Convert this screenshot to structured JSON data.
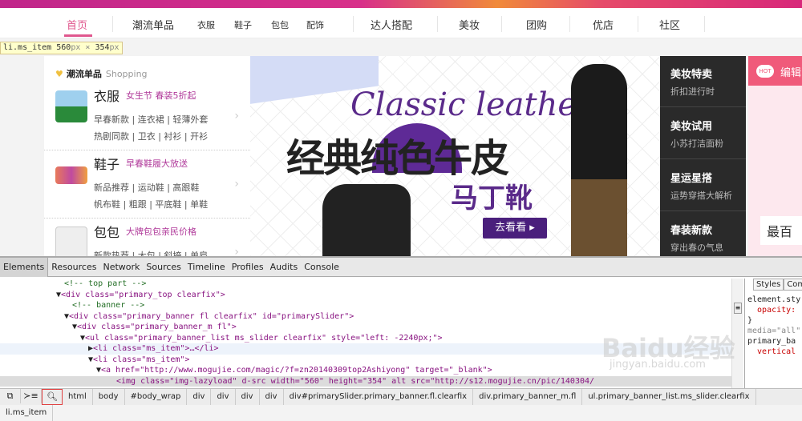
{
  "nav": {
    "items": [
      "首页",
      "潮流单品",
      "衣服",
      "鞋子",
      "包包",
      "配饰",
      "达人搭配",
      "美妆",
      "团购",
      "优店",
      "社区"
    ]
  },
  "tooltip": {
    "selector": "li.ms_item",
    "width": "560",
    "height": "354",
    "unit": "px",
    "times": "×"
  },
  "left_panel": {
    "heading": "潮流单品",
    "heading_en": "Shopping",
    "categories": [
      {
        "title": "衣服",
        "promo": "女生节 春装5折起",
        "row1": "早春新款 | 连衣裙 | 轻薄外套",
        "row2": "热剧同款 | 卫衣 | 衬衫 | 开衫"
      },
      {
        "title": "鞋子",
        "promo": "早春鞋履大放送",
        "row1": "新品推荐 | 运动鞋 | 高跟鞋",
        "row2": "帆布鞋 | 粗跟 | 平底鞋 | 单鞋"
      },
      {
        "title": "包包",
        "promo": "大牌包包亲民价格",
        "row1": "新款热荐 | 大包 | 斜挎 | 单肩"
      }
    ]
  },
  "banner": {
    "script": "Classic leather",
    "headline": "经典纯色牛皮",
    "sub": "马丁靴",
    "button": "去看看 ▸",
    "accent": "#4a1f7c"
  },
  "dark_menu": [
    {
      "title": "美妆特卖",
      "sub": "折扣进行时"
    },
    {
      "title": "美妆试用",
      "sub": "小苏打洁面粉"
    },
    {
      "title": "星运星搭",
      "sub": "运势穿搭大解析"
    },
    {
      "title": "春装新款",
      "sub": "穿出春の气息"
    }
  ],
  "right_card": {
    "badge": "HOT",
    "title": "编辑",
    "box": "最百"
  },
  "devtools": {
    "tabs": [
      "Elements",
      "Resources",
      "Network",
      "Sources",
      "Timeline",
      "Profiles",
      "Audits",
      "Console"
    ],
    "code": [
      "<!-- top part -->",
      "<div class=\"primary_top clearfix\">",
      "<!-- banner -->",
      "<div class=\"primary_banner fl clearfix\" id=\"primarySlider\">",
      "<div class=\"primary_banner_m fl\">",
      "<ul class=\"primary_banner_list ms_slider clearfix\" style=\"left: -2240px;\">",
      "<li class=\"ms_item\">…</li>",
      "<li class=\"ms_item\">",
      "<a href=\"http://www.mogujie.com/magic/?f=zn20140309top2Ashiyong\" target=\"_blank\">",
      "<img class=\"img-lazyload\" d-src width=\"560\" height=\"354\" alt src=\"http://s12.mogujie.cn/pic/140304/"
    ],
    "styles_tabs": [
      "Styles",
      "Com"
    ],
    "styles_lines": [
      "element.sty",
      "  opacity:",
      "}",
      "media=\"all\"",
      "",
      "primary_ba",
      "  vertical",
      "}"
    ],
    "breadcrumbs": [
      "html",
      "body",
      "#body_wrap",
      "div",
      "div",
      "div",
      "div",
      "div#primarySlider.primary_banner.fl.clearfix",
      "div.primary_banner_m.fl",
      "ul.primary_banner_list.ms_slider.clearfix",
      "li.ms_item"
    ]
  },
  "watermark": {
    "logo": "Baidu经验",
    "url": "jingyan.baidu.com"
  }
}
